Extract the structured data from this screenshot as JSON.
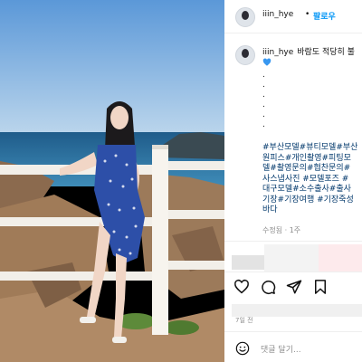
{
  "header": {
    "username": "iiin_hye",
    "separator": "•",
    "follow_label": "팔로우"
  },
  "caption": {
    "username": "iiin_hye",
    "text": "바람도 적당히 불",
    "emoji_icon": "blue-heart-icon",
    "dots": [
      ".",
      ".",
      ".",
      ".",
      ".",
      "."
    ],
    "hashtag_lines": [
      "#부산모델#뷰티모델#부산",
      "원피스#개인촬영#피팅모",
      "델#촬영문의#협찬문의#",
      "사스냅사진 #모델포즈 #",
      "대구모델#소수출사#출사",
      "기장#기장여행 #기장죽성",
      "바다"
    ],
    "meta": "수정됨 · 1주"
  },
  "actions": [
    "heart-icon",
    "comment-icon",
    "share-icon",
    "save-icon"
  ],
  "date": "7일 전",
  "comment": {
    "emoji_icon": "smiley-icon",
    "placeholder": "댓글 달기..."
  },
  "colors": {
    "link": "#00376b",
    "follow": "#0095f6",
    "heart": "#3897f0"
  }
}
